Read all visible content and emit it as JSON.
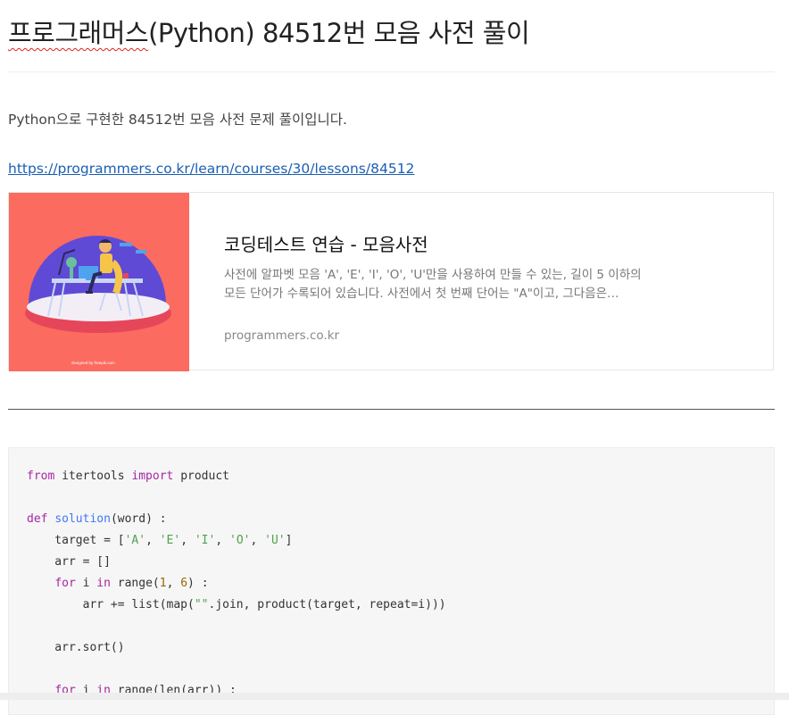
{
  "post": {
    "title_spell": "프로그래머스",
    "title_rest": "(Python) 84512번 모음 사전 풀이",
    "intro": "Python으로 구현한 84512번 모음 사전 문제 풀이입니다.",
    "link_url": "https://programmers.co.kr/learn/courses/30/lessons/84512"
  },
  "card": {
    "thumb_credit": "designed by freepik.com",
    "title": "코딩테스트 연습 - 모음사전",
    "desc_line1": "사전에 알파벳 모음 'A', 'E', 'I', 'O', 'U'만을 사용하여 만들 수 있는, 길이 5 이하의",
    "desc_line2": "모든 단어가 수록되어 있습니다. 사전에서 첫 번째 단어는 \"A\"이고, 그다음은…",
    "host": "programmers.co.kr"
  },
  "code": {
    "l1": {
      "a": "from",
      "b": " itertools ",
      "c": "import",
      "d": " product"
    },
    "l2": {
      "a": "def",
      "b": " ",
      "c": "solution",
      "d": "(word) :"
    },
    "l3": {
      "a": "    target = [",
      "s1": "'A'",
      "s2": "'E'",
      "s3": "'I'",
      "s4": "'O'",
      "s5": "'U'",
      "sep": ", ",
      "z": "]"
    },
    "l4": "    arr = []",
    "l5": {
      "a": "    ",
      "b": "for",
      "c": " i ",
      "d": "in",
      "e": " range(",
      "n1": "1",
      "f": ", ",
      "n2": "6",
      "g": ") :"
    },
    "l6": {
      "a": "        arr += list(map(",
      "s": "\"\"",
      "b": ".join, product(target, repeat=i)))"
    },
    "l7": "    arr.sort()",
    "l8": {
      "a": "    ",
      "b": "for",
      "c": " i ",
      "d": "in",
      "e": " range(len(arr)) :"
    }
  },
  "colors": {
    "link": "#1a5fb4",
    "thumb_bg": "#fb6b5f",
    "keyword": "#a626a4",
    "function": "#4078f2",
    "string": "#50a14f",
    "number": "#986801"
  }
}
